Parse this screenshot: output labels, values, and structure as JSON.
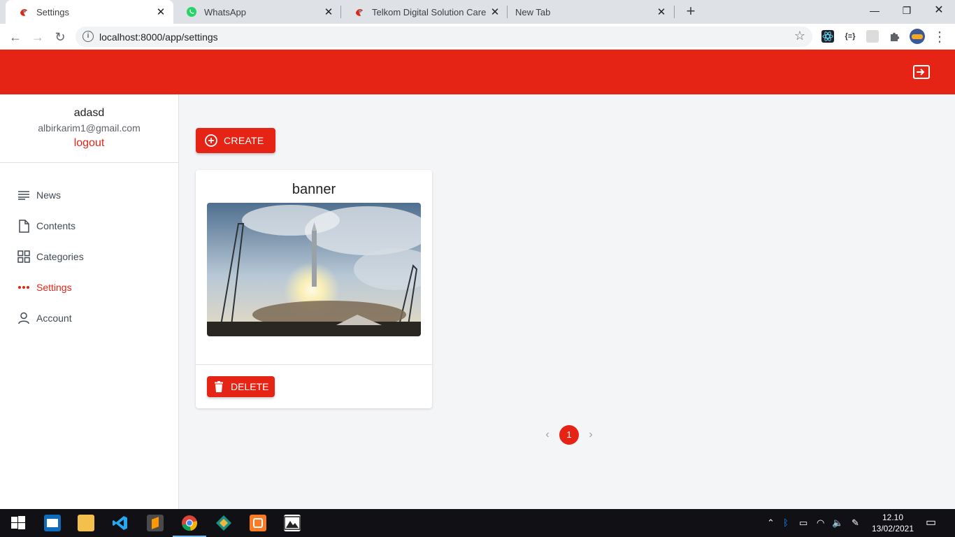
{
  "browser": {
    "tabs": [
      {
        "title": "Settings",
        "active": true,
        "icon": "telkom-favicon"
      },
      {
        "title": "WhatsApp",
        "active": false,
        "icon": "whatsapp-icon"
      },
      {
        "title": "Telkom Digital Solution Care Cen",
        "active": false,
        "icon": "telkom-favicon"
      },
      {
        "title": "New Tab",
        "active": false,
        "icon": ""
      }
    ],
    "url": "localhost:8000/app/settings"
  },
  "user": {
    "name": "adasd",
    "email": "albirkarim1@gmail.com",
    "logout_label": "logout"
  },
  "sidebar": {
    "items": [
      {
        "label": "News",
        "icon": "lines-icon",
        "active": false
      },
      {
        "label": "Contents",
        "icon": "document-icon",
        "active": false
      },
      {
        "label": "Categories",
        "icon": "grid-icon",
        "active": false
      },
      {
        "label": "Settings",
        "icon": "dots-icon",
        "active": true
      },
      {
        "label": "Account",
        "icon": "person-icon",
        "active": false
      }
    ]
  },
  "main": {
    "create_label": "CREATE",
    "cards": [
      {
        "title": "banner",
        "image": "rocket-launch-photo",
        "delete_label": "DELETE"
      }
    ],
    "pagination": {
      "current_page": "1"
    }
  },
  "taskbar": {
    "time": "12.10",
    "date": "13/02/2021"
  },
  "colors": {
    "accent": "#e52416",
    "background": "#f4f5f7"
  }
}
